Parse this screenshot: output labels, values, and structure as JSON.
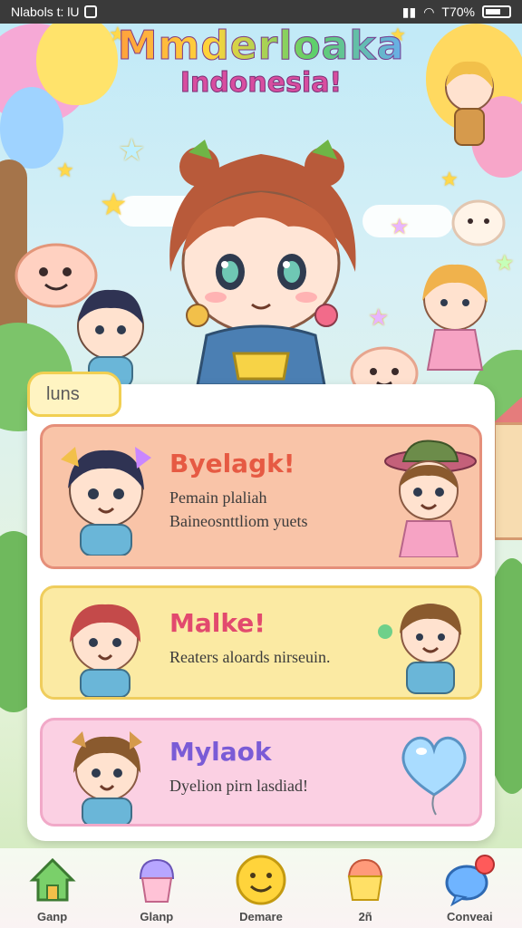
{
  "status_bar": {
    "left_text": "Nlabols t: lU",
    "battery_text": "T70%"
  },
  "header": {
    "title_line1": "Mmderloaka",
    "title_line2": "Indonesia!"
  },
  "panel": {
    "tab_label": "luns",
    "cards": [
      {
        "title": "Byelagk!",
        "desc_line1": "Pemain plaliah",
        "desc_line2": "Baineosnttliom yuets",
        "accent": "#e65a43"
      },
      {
        "title": "Malke!",
        "desc_line1": "Reaters aloards nirseuin.",
        "accent": "#e24a6e"
      },
      {
        "title": "Mylaok",
        "desc_line1": "Dyelion pirn lasdiad!",
        "accent": "#7a5bd6"
      }
    ]
  },
  "bottom_nav": {
    "items": [
      {
        "label": "Ganp",
        "icon": "house-icon"
      },
      {
        "label": "Glanp",
        "icon": "cupcake-icon"
      },
      {
        "label": "Demare",
        "icon": "smiley-icon"
      },
      {
        "label": "2ñ",
        "icon": "cake-icon"
      },
      {
        "label": "Conveai",
        "icon": "chat-bubble-icon"
      }
    ]
  }
}
